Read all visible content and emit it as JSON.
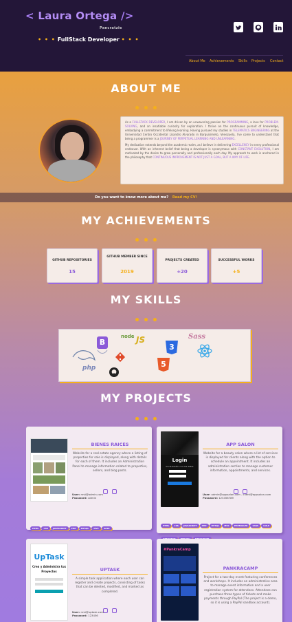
{
  "header": {
    "logo_open": "< ",
    "logo_name": "Laura Ortega",
    "logo_close": " />",
    "logo_sub": "Pancratzie",
    "role_dots_left": "• • •",
    "role": "FullStack Developer",
    "role_dots_right": "• • •",
    "social": [
      "twitter-icon",
      "github-icon",
      "linkedin-icon"
    ],
    "nav": [
      "About Me",
      "Achievements",
      "Skills",
      "Projects",
      "Contact"
    ]
  },
  "about": {
    "title": "ABOUT ME",
    "p1_a": "As a ",
    "p1_h1": "FULLSTACK DEVELOPER",
    "p1_b": ", I am driven by an unwavering passion for ",
    "p1_h2": "PROGRAMMING",
    "p1_c": ", a love for ",
    "p1_h3": "PROBLEM-SOLVING",
    "p1_d": ", and an insatiable curiosity for exploration. I thrive on the continuous pursuit of knowledge, embodying a commitment to lifelong learning. Having pursued my studies in ",
    "p1_h4": "TELEMATICS ENGINEERING",
    "p1_e": " at the Universidad Centro Occidental Lisandro Alvarado in Barquisimeto, Venezuela, I've come to understand that being a programmer is a ",
    "p1_h5": "JOURNEY OF PERPETUAL LEARNING AND UNLEARNING",
    "p1_f": ".",
    "p2_a": "My dedication extends beyond the academic realm, as I believe in delivering ",
    "p2_h1": "EXCELLENCY",
    "p2_b": " in every professional endeavor. With an inherent belief that being a developer is synonymous with ",
    "p2_h2": "CONSTANT EVOLUTION",
    "p2_c": ", I am motivated by the desire to grow personally and professionally each day. My approach to work is anchored in the philosophy that ",
    "p2_h3": "CONTINUOUS IMPROVEMENT IS NOT JUST A GOAL, BUT A WAY OF LIFE",
    "p2_d": ".",
    "cv_question": "Do you want to know more about me?",
    "cv_link": "Read my CV!"
  },
  "achievements": {
    "title": "MY ACHIEVEMENTS",
    "items": [
      {
        "label": "GITHUB REPOSITORIES",
        "value": "15",
        "color": "#8b5ad8"
      },
      {
        "label": "GITHUB MEMBER SINCE",
        "value": "2019",
        "color": "#f5b01a"
      },
      {
        "label": "PROJECTS CREATED",
        "value": "+20",
        "color": "#8b5ad8"
      },
      {
        "label": "SUCCESSFUL WORKS",
        "value": "+5",
        "color": "#f5b01a"
      }
    ]
  },
  "skills": {
    "title": "MY SKILLS",
    "icons": [
      "mysql-icon",
      "php-icon",
      "bootstrap-icon",
      "nodejs-icon",
      "git-icon",
      "github-icon",
      "css3-icon",
      "html5-icon",
      "sass-icon",
      "react-icon"
    ],
    "php_text": "php",
    "node_text": "node",
    "bootstrap_text": "B",
    "css_text": "3",
    "html_text": "5",
    "sass_text": "Sass"
  },
  "projects": {
    "title": "MY PROJECTS",
    "items": [
      {
        "title": "BIENES RAICES",
        "desc": "Website for a real estate agency where a listing of properties for sale is displayed, along with details for each of them. It includes an Administration Panel to manage information related to properties, sellers, and blog posts.",
        "user_label": "User:",
        "user": "mvt@admin.com",
        "pass_label": "Password:",
        "pass": "admin",
        "tags": [
          "HTML",
          "CSS",
          "JAVASCRIPT",
          "PHP",
          "MYSQL",
          "MVC",
          "SASS"
        ]
      },
      {
        "title": "APP SALON",
        "desc": "Website for a beauty salon where a list of services is displayed for clients along with the option to schedule an appointment. It includes an administration section to manage customer information, appointments, and services.",
        "user_label": "User:",
        "user": "admin@appsalon.com - client@appsalon.com",
        "pass_label": "Password:",
        "pass": "123456789",
        "tags": [
          "HTML",
          "CSS",
          "JAVASCRIPT",
          "PHP",
          "MYSQL",
          "MVC",
          "PHPMAILER",
          "SASS",
          "GULP",
          "DEBOUNCE",
          "HEROKU",
          "DEBOUNCER"
        ],
        "shot_login": "Login",
        "shot_login_sub": "Inicia Sesión con tus datos"
      },
      {
        "title": "UPTASK",
        "desc": "A simple task application where each user can register and create projects, consisting of tasks that can be deleted, modified, and marked as completed.",
        "user_label": "User:",
        "user": "mvt@uptask.com",
        "pass_label": "Password:",
        "pass": "123456",
        "shot_brand": "UpTask",
        "shot_sub": "Crea y Administra tus Proyectos"
      },
      {
        "title": "PANKRACAMP",
        "desc": "Project for a two-day event featuring conferences and workshops. It includes an administrative area to manage event information and a user registration system for attendees. Attendees can purchase three types of tickets and make payments through PayPal (The project is a demo, so it is using a PayPal sandbox account).",
        "shot_brand": "#PankraCamp"
      }
    ]
  }
}
